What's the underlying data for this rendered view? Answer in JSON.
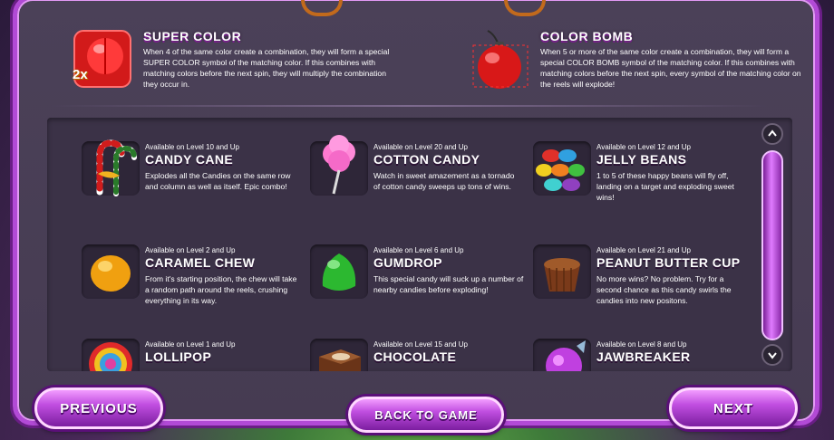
{
  "features": [
    {
      "title": "SUPER COLOR",
      "desc": "When 4 of the same color create a combination, they will form a special SUPER COLOR symbol of the matching color. If this combines with matching colors before the next spin, they will multiply the combination they occur in.",
      "badge": "2x",
      "icon": "red-super-color-candy-icon"
    },
    {
      "title": "COLOR BOMB",
      "desc": "When 5 or more of the same color create a combination, they will form a special COLOR BOMB symbol of the matching color. If this combines with matching colors before the next spin, every symbol of the matching color on the reels will explode!",
      "icon": "red-color-bomb-icon"
    }
  ],
  "candies": [
    {
      "level": "Available on Level 10 and Up",
      "name": "CANDY CANE",
      "text": "Explodes all the Candies on the same row and column as well as itself. Epic combo!",
      "icon": "candy-cane-icon"
    },
    {
      "level": "Available on Level 20 and Up",
      "name": "COTTON CANDY",
      "text": "Watch in sweet amazement as a tornado of cotton candy sweeps up tons of wins.",
      "icon": "cotton-candy-icon"
    },
    {
      "level": "Available on Level 12 and Up",
      "name": "JELLY BEANS",
      "text": "1 to 5 of these happy beans will fly off, landing on a target and exploding sweet wins!",
      "icon": "jelly-beans-icon"
    },
    {
      "level": "Available on Level 2 and Up",
      "name": "CARAMEL CHEW",
      "text": "From it's starting position, the chew will take a random path around the reels, crushing everything in its way.",
      "icon": "caramel-chew-icon"
    },
    {
      "level": "Available on Level 6 and Up",
      "name": "GUMDROP",
      "text": "This special candy will suck up a number of nearby candies before exploding!",
      "icon": "gumdrop-icon"
    },
    {
      "level": "Available on Level 21 and Up",
      "name": "PEANUT BUTTER CUP",
      "text": "No more wins? No problem. Try for a second chance as this candy swirls the candies into new positons.",
      "icon": "peanut-butter-cup-icon"
    },
    {
      "level": "Available on Level 1 and Up",
      "name": "LOLLIPOP",
      "text": "",
      "icon": "lollipop-icon"
    },
    {
      "level": "Available on Level 15 and Up",
      "name": "CHOCOLATE",
      "text": "",
      "icon": "chocolate-icon"
    },
    {
      "level": "Available on Level 8 and Up",
      "name": "JAWBREAKER",
      "text": "",
      "icon": "jawbreaker-icon"
    }
  ],
  "scroll": {
    "up": "^",
    "down": "v"
  },
  "buttons": {
    "previous": "PREVIOUS",
    "back": "BACK TO GAME",
    "next": "NEXT"
  }
}
